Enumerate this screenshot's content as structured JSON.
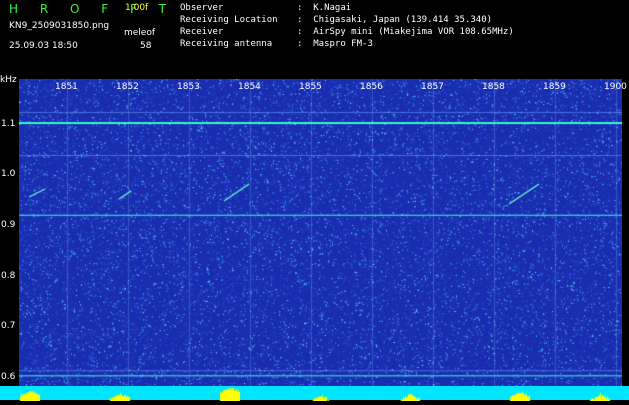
{
  "header": {
    "brand": "H R O F F T",
    "version": "1.00f",
    "filename": "KN9_2509031850.png",
    "app": "meleof",
    "datetime": "25.09.03 18:50",
    "count": "58"
  },
  "metadata": [
    {
      "key": "Observer",
      "value": ":  K.Nagai"
    },
    {
      "key": "Receiving Location",
      "value": ":  Chigasaki, Japan (139.414 35.340)"
    },
    {
      "key": "Receiver",
      "value": ":  AirSpy mini (Miakejima VOR 108.65MHz)"
    },
    {
      "key": "Receiving antenna",
      "value": ":  Maspro FM-3"
    }
  ],
  "spectrogram": {
    "unit": "kHz",
    "y_ticks": [
      "1.1",
      "1.0",
      "0.9",
      "0.8",
      "0.7",
      "0.6"
    ],
    "y_values": [
      1.1,
      1.0,
      0.9,
      0.8,
      0.7,
      0.6
    ],
    "ylim": [
      0.58,
      1.19
    ],
    "x_ticks": [
      "1851",
      "1852",
      "1853",
      "1854",
      "1855",
      "1856",
      "1857",
      "1858",
      "1859",
      "1900"
    ],
    "xlim": [
      0,
      10
    ],
    "carrier_lines_khz": [
      1.105,
      0.922,
      0.605
    ],
    "faint_lines_khz": [
      1.125,
      1.04,
      0.615
    ],
    "colors": {
      "background": "#1a2db0",
      "noise": "#5ad0ff",
      "carrier": "#33ffcc",
      "band": "#00e5ff",
      "peaks": "#ffff00"
    }
  }
}
